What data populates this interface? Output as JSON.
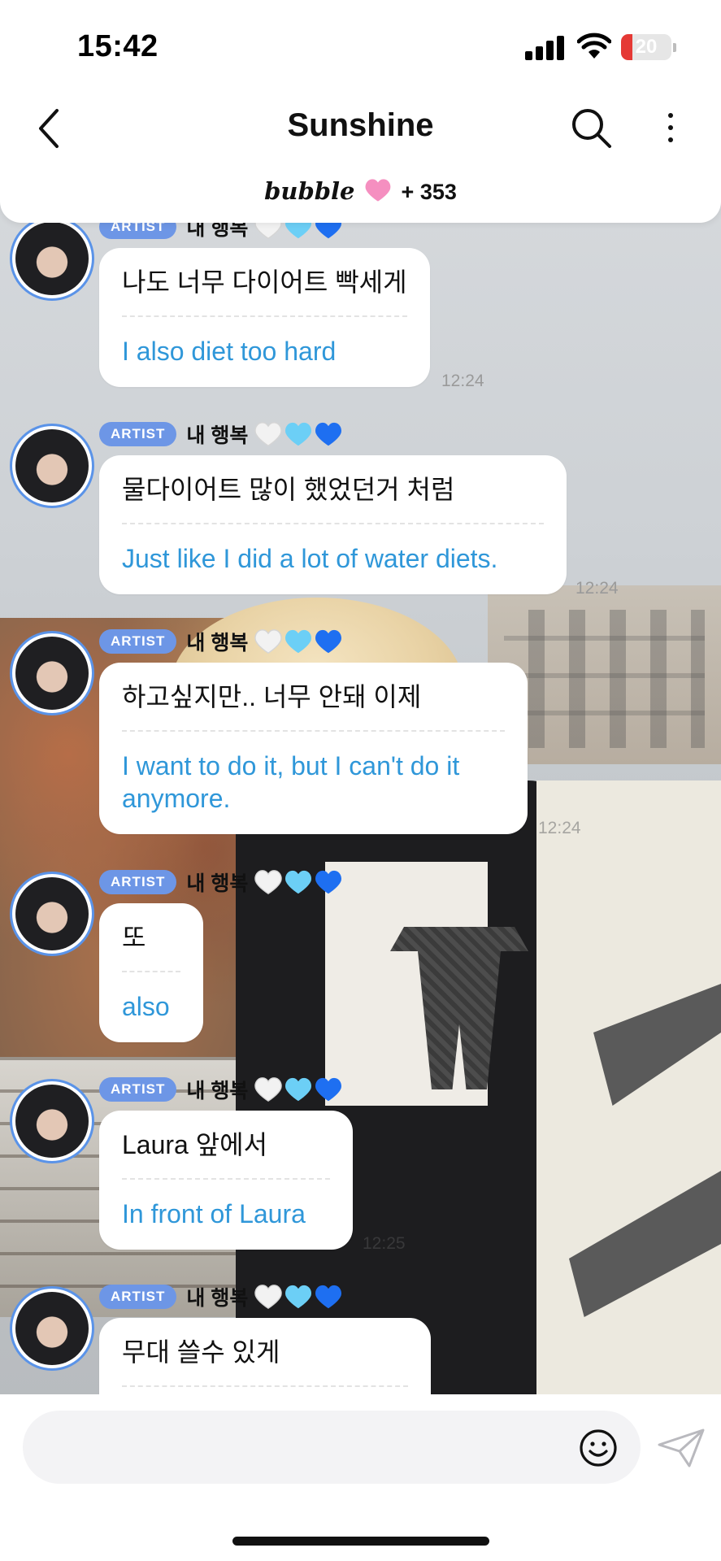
{
  "status_bar": {
    "time": "15:42",
    "battery_level": "20",
    "icons": [
      "cellular-signal-icon",
      "wifi-icon",
      "battery-icon"
    ]
  },
  "header": {
    "title": "Sunshine",
    "brand": "bubble",
    "member_count": "+ 353",
    "icons": [
      "back-chevron-icon",
      "search-icon",
      "more-vertical-icon",
      "pink-heart-icon"
    ]
  },
  "colors": {
    "badge": "#6d96e6",
    "translation_text": "#2f97d9",
    "avatar_ring": "#5a93e8",
    "heart_white": "#f2f2f2",
    "heart_light_blue": "#6ccff6",
    "heart_blue": "#1e6ff1"
  },
  "messages": [
    {
      "badge": "ARTIST",
      "nickname": "내 행복",
      "hearts": [
        "white-heart-icon",
        "light-blue-heart-icon",
        "blue-heart-icon"
      ],
      "korean": "나도 너무 다이어트 빡세게",
      "translation": "I also diet too hard",
      "time": "12:24"
    },
    {
      "badge": "ARTIST",
      "nickname": "내 행복",
      "hearts": [
        "white-heart-icon",
        "light-blue-heart-icon",
        "blue-heart-icon"
      ],
      "korean": "물다이어트 많이 했었던거 처럼",
      "translation": "Just like I did a lot of water diets.",
      "time": "12:24"
    },
    {
      "badge": "ARTIST",
      "nickname": "내 행복",
      "hearts": [
        "white-heart-icon",
        "light-blue-heart-icon",
        "blue-heart-icon"
      ],
      "korean": "하고싶지만.. 너무 안돼 이제",
      "translation": "I want to do it, but I can't do it anymore.",
      "time": "12:24"
    },
    {
      "badge": "ARTIST",
      "nickname": "내 행복",
      "hearts": [
        "white-heart-icon",
        "light-blue-heart-icon",
        "blue-heart-icon"
      ],
      "korean": "또",
      "translation": "also",
      "time": ""
    },
    {
      "badge": "ARTIST",
      "nickname": "내 행복",
      "hearts": [
        "white-heart-icon",
        "light-blue-heart-icon",
        "blue-heart-icon"
      ],
      "korean": "Laura 앞에서",
      "translation": "In front of Laura",
      "time": "12:25"
    },
    {
      "badge": "ARTIST",
      "nickname": "내 행복",
      "hearts": [
        "white-heart-icon",
        "light-blue-heart-icon",
        "blue-heart-icon"
      ],
      "korean": "무대 쓸수 있게",
      "translation": "",
      "time": ""
    }
  ],
  "composer": {
    "placeholder": "",
    "icons": [
      "emoji-smile-icon",
      "send-paper-plane-icon"
    ]
  }
}
